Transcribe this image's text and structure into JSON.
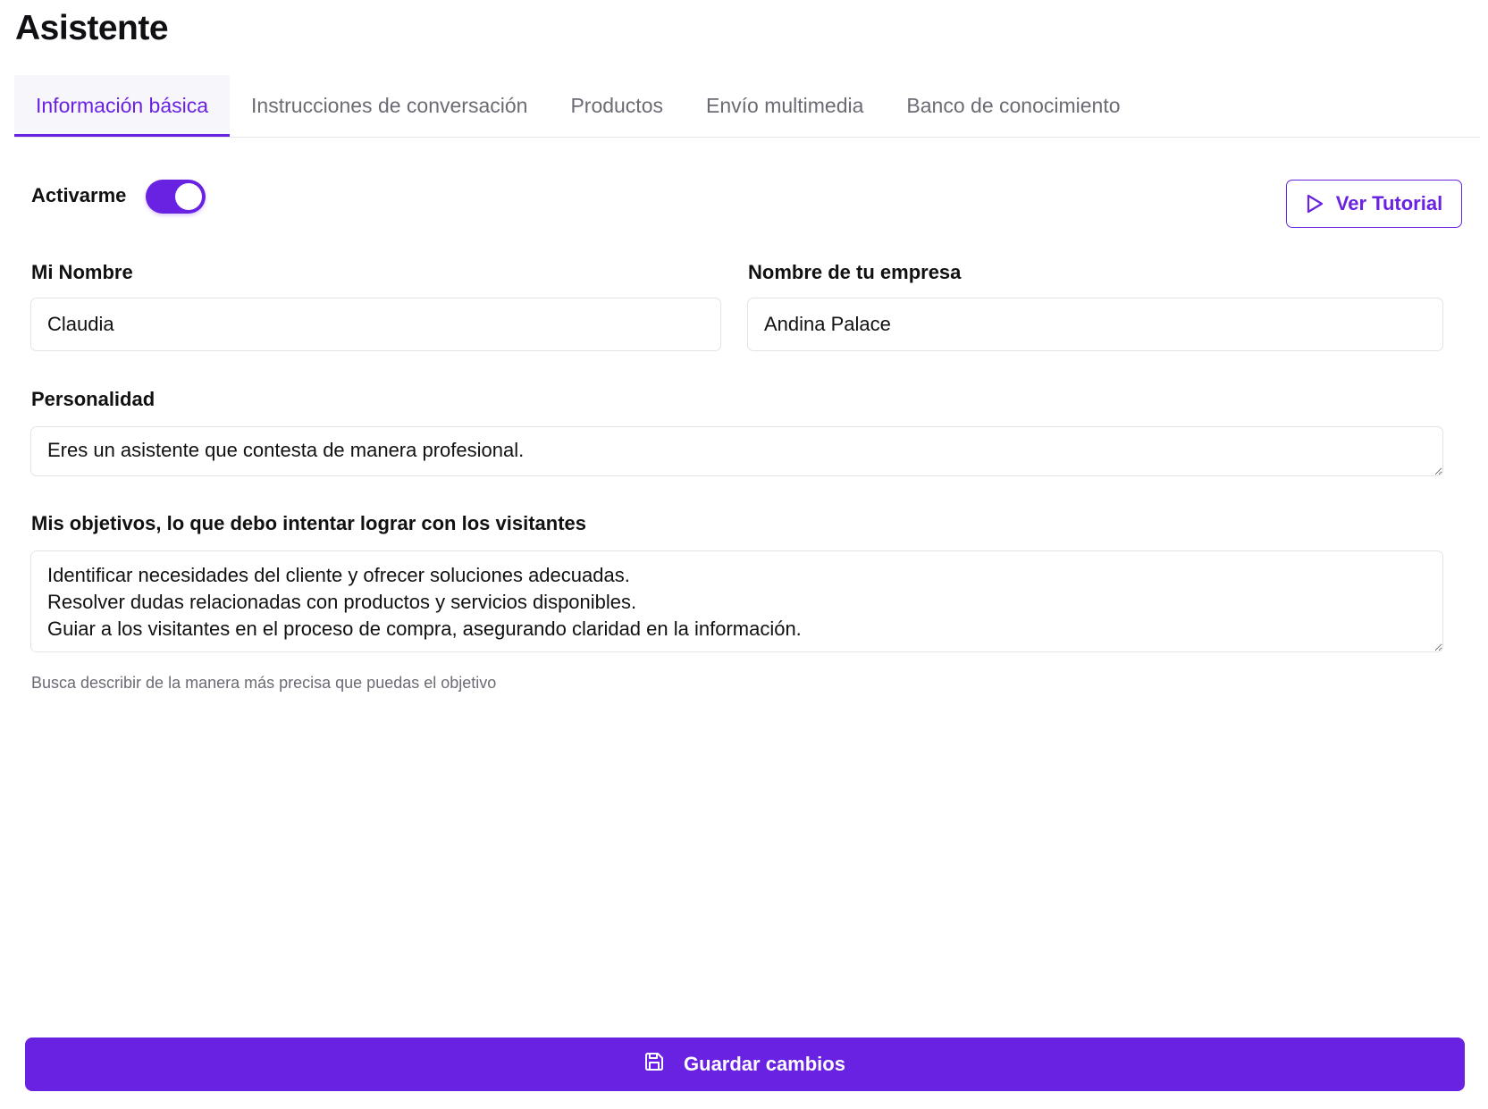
{
  "page": {
    "title": "Asistente"
  },
  "tabs": [
    {
      "label": "Información básica",
      "active": true
    },
    {
      "label": "Instrucciones de conversación",
      "active": false
    },
    {
      "label": "Productos",
      "active": false
    },
    {
      "label": "Envío multimedia",
      "active": false
    },
    {
      "label": "Banco de conocimiento",
      "active": false
    }
  ],
  "activation": {
    "label": "Activarme",
    "enabled": true
  },
  "tutorial": {
    "label": "Ver Tutorial",
    "icon": "play-icon"
  },
  "form": {
    "name": {
      "label": "Mi Nombre",
      "value": "Claudia"
    },
    "company": {
      "label": "Nombre de tu empresa",
      "value": "Andina Palace"
    },
    "personality": {
      "label": "Personalidad",
      "value": "Eres un asistente que contesta de manera profesional."
    },
    "objectives": {
      "label": "Mis objetivos, lo que debo intentar lograr con los visitantes",
      "value": "Identificar necesidades del cliente y ofrecer soluciones adecuadas.\nResolver dudas relacionadas con productos y servicios disponibles.\nGuiar a los visitantes en el proceso de compra, asegurando claridad en la información.",
      "helper": "Busca describir de la manera más precisa que puedas el objetivo"
    }
  },
  "save": {
    "label": "Guardar cambios",
    "icon": "save-icon"
  },
  "colors": {
    "accent": "#6a22e2",
    "border": "#e2e3e8",
    "muted": "#6b6b75"
  }
}
